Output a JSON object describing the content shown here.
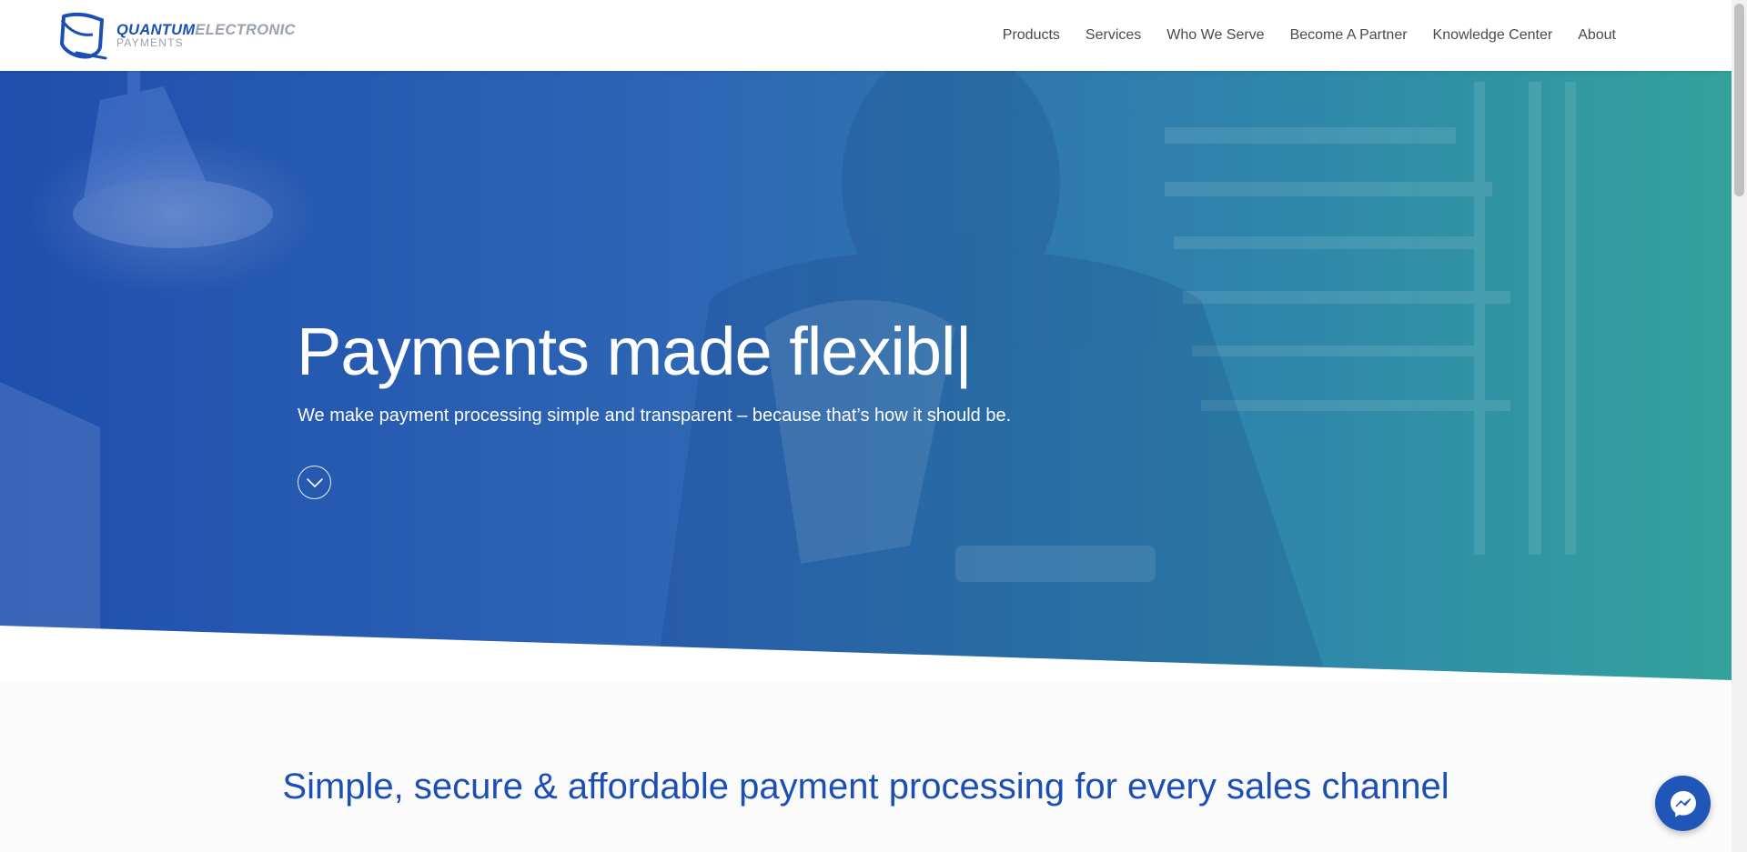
{
  "brand": {
    "name_primary": "QUANTUM",
    "name_secondary": "ELECTRONIC",
    "tagline": "PAYMENTS",
    "icon": "quantum-logo-icon",
    "primary_color": "#1c4fb3",
    "secondary_color": "#9aa3ad"
  },
  "nav": {
    "items": [
      {
        "label": "Products"
      },
      {
        "label": "Services"
      },
      {
        "label": "Who We Serve"
      },
      {
        "label": "Become A Partner"
      },
      {
        "label": "Knowledge Center"
      },
      {
        "label": "About"
      }
    ]
  },
  "hero": {
    "title": "Payments made flexibl|",
    "subtitle": "We make payment processing simple and transparent – because that’s how it should be.",
    "scroll_icon": "chevron-down-icon",
    "gradient_start": "#1f4fae",
    "gradient_end": "#33a29c"
  },
  "section": {
    "headline": "Simple, secure & affordable payment processing for every sales channel"
  },
  "chat": {
    "icon": "messenger-icon",
    "color": "#1f56b8"
  }
}
